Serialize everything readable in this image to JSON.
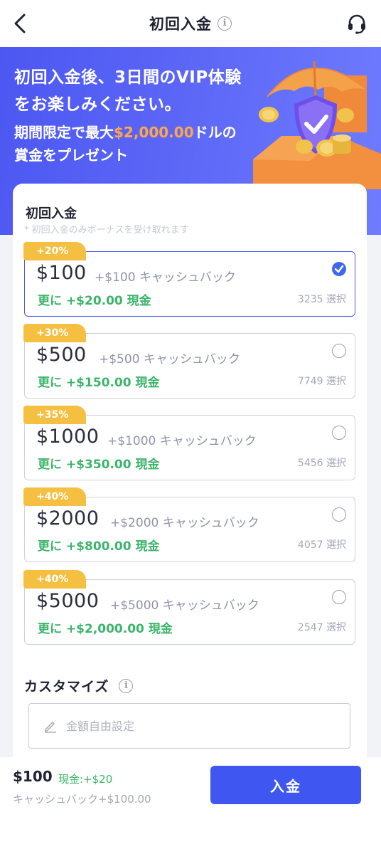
{
  "header": {
    "title": "初回入金",
    "info_icon": "info-icon",
    "back_icon": "chevron-left-icon",
    "support_icon": "headset-icon"
  },
  "banner": {
    "line1a": "初回入金後、3日間のVIP体験",
    "line1b": "をお楽しみください。",
    "line2_prefix": "期間限定で最大",
    "line2_amount": "$2,000.00",
    "line2_suffix": "ドルの",
    "line3": "賞金をプレゼント"
  },
  "section": {
    "title": "初回入金",
    "note": "* 初回入金のみボーナスを受け取れます"
  },
  "options": [
    {
      "badge": "+20%",
      "amount": "$100",
      "cashback": "+$100 キャッシュバック",
      "bonus": "更に +$20.00 現金",
      "count": "3235 選択",
      "selected": true
    },
    {
      "badge": "+30%",
      "amount": "$500",
      "cashback": "+$500 キャッシュバック",
      "bonus": "更に +$150.00 現金",
      "count": "7749 選択",
      "selected": false
    },
    {
      "badge": "+35%",
      "amount": "$1000",
      "cashback": "+$1000 キャッシュバック",
      "bonus": "更に +$350.00 現金",
      "count": "5456 選択",
      "selected": false
    },
    {
      "badge": "+40%",
      "amount": "$2000",
      "cashback": "+$2000 キャッシュバック",
      "bonus": "更に +$800.00 現金",
      "count": "4057 選択",
      "selected": false
    },
    {
      "badge": "+40%",
      "amount": "$5000",
      "cashback": "+$5000 キャッシュバック",
      "bonus": "更に +$2,000.00 現金",
      "count": "2547 選択",
      "selected": false
    }
  ],
  "custom": {
    "title": "カスタマイズ",
    "placeholder": "金額自由設定",
    "value": ""
  },
  "bottom": {
    "amount": "$100",
    "cash": "現金:+$20",
    "cashback": "キャッシュバック+$100.00",
    "button_label": "入金"
  },
  "colors": {
    "accent": "#3f56f0",
    "banner": "#5b66f6",
    "badge": "#f5c042",
    "bonus_green": "#3bb56a",
    "highlight_orange": "#ffa64a"
  }
}
